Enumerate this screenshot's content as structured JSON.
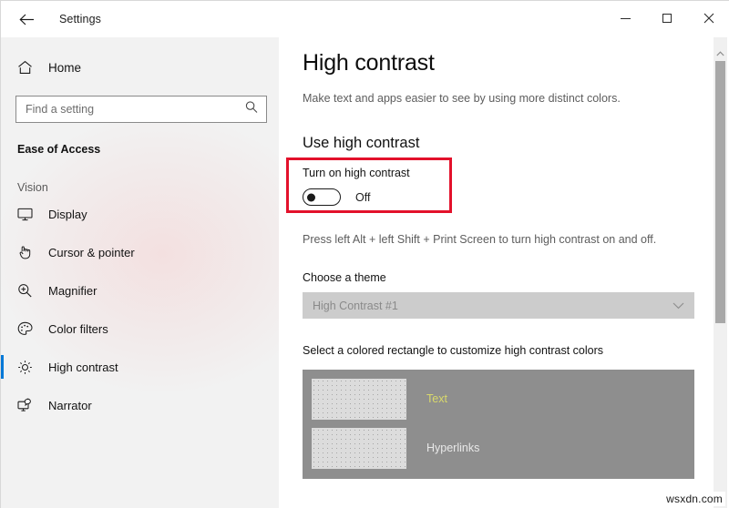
{
  "window": {
    "back_icon": "back-arrow-icon",
    "title": "Settings",
    "minimize_label": "Minimize",
    "maximize_label": "Maximize",
    "close_label": "Close"
  },
  "sidebar": {
    "home": {
      "icon": "home-icon",
      "label": "Home"
    },
    "search": {
      "placeholder": "Find a setting",
      "icon": "search-icon"
    },
    "category": "Ease of Access",
    "group_label": "Vision",
    "items": [
      {
        "icon": "monitor-icon",
        "label": "Display",
        "selected": false
      },
      {
        "icon": "cursor-pointer-icon",
        "label": "Cursor & pointer",
        "selected": false
      },
      {
        "icon": "magnifier-icon",
        "label": "Magnifier",
        "selected": false
      },
      {
        "icon": "palette-icon",
        "label": "Color filters",
        "selected": false
      },
      {
        "icon": "brightness-sun-icon",
        "label": "High contrast",
        "selected": true
      },
      {
        "icon": "narrator-icon",
        "label": "Narrator",
        "selected": false
      }
    ],
    "accent_color": "#0078d7"
  },
  "main": {
    "page_title": "High contrast",
    "page_subtitle": "Make text and apps easier to see by using more distinct colors.",
    "section_heading": "Use high contrast",
    "toggle": {
      "label": "Turn on high contrast",
      "state": "Off",
      "highlight_color": "#e3112b"
    },
    "keyboard_hint": "Press left Alt + left Shift + Print Screen to turn high contrast on and off.",
    "theme_label": "Choose a theme",
    "theme_value": "High Contrast #1",
    "theme_chevron_icon": "chevron-down-icon",
    "customize_label": "Select a colored rectangle to customize high contrast colors",
    "swatches": [
      {
        "name": "Text",
        "text_color": "#d9d96b",
        "swatch_color": "#dcdcdc"
      },
      {
        "name": "Hyperlinks",
        "text_color": "#e8e8e8",
        "swatch_color": "#dcdcdc"
      }
    ],
    "panel_background": "#8e8e8e"
  },
  "scrollbar": {
    "up_arrow_icon": "chevron-up-icon"
  },
  "watermark": "wsxdn.com"
}
